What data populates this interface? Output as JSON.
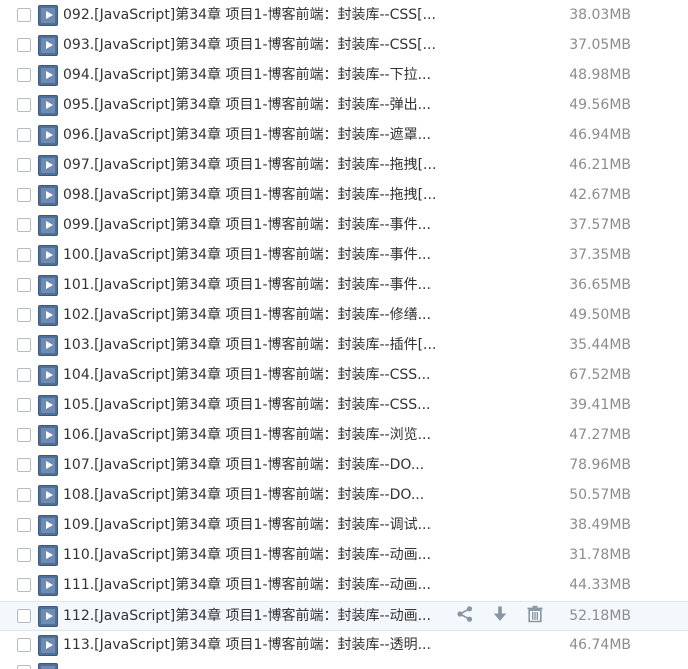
{
  "files": [
    {
      "name": "092.[JavaScript]第34章 项目1-博客前端：封装库--CSS[...",
      "size": "38.03MB"
    },
    {
      "name": "093.[JavaScript]第34章 项目1-博客前端：封装库--CSS[...",
      "size": "37.05MB"
    },
    {
      "name": "094.[JavaScript]第34章 项目1-博客前端：封装库--下拉...",
      "size": "48.98MB"
    },
    {
      "name": "095.[JavaScript]第34章 项目1-博客前端：封装库--弹出...",
      "size": "49.56MB"
    },
    {
      "name": "096.[JavaScript]第34章 项目1-博客前端：封装库--遮罩...",
      "size": "46.94MB"
    },
    {
      "name": "097.[JavaScript]第34章 项目1-博客前端：封装库--拖拽[...",
      "size": "46.21MB"
    },
    {
      "name": "098.[JavaScript]第34章 项目1-博客前端：封装库--拖拽[...",
      "size": "42.67MB"
    },
    {
      "name": "099.[JavaScript]第34章 项目1-博客前端：封装库--事件...",
      "size": "37.57MB"
    },
    {
      "name": "100.[JavaScript]第34章 项目1-博客前端：封装库--事件...",
      "size": "37.35MB"
    },
    {
      "name": "101.[JavaScript]第34章 项目1-博客前端：封装库--事件...",
      "size": "36.65MB"
    },
    {
      "name": "102.[JavaScript]第34章 项目1-博客前端：封装库--修缮...",
      "size": "49.50MB"
    },
    {
      "name": "103.[JavaScript]第34章 项目1-博客前端：封装库--插件[...",
      "size": "35.44MB"
    },
    {
      "name": "104.[JavaScript]第34章 项目1-博客前端：封装库--CSS...",
      "size": "67.52MB"
    },
    {
      "name": "105.[JavaScript]第34章 项目1-博客前端：封装库--CSS...",
      "size": "39.41MB"
    },
    {
      "name": "106.[JavaScript]第34章 项目1-博客前端：封装库--浏览...",
      "size": "47.27MB"
    },
    {
      "name": "107.[JavaScript]第34章 项目1-博客前端：封装库--DO...",
      "size": "78.96MB"
    },
    {
      "name": "108.[JavaScript]第34章 项目1-博客前端：封装库--DO...",
      "size": "50.57MB"
    },
    {
      "name": "109.[JavaScript]第34章 项目1-博客前端：封装库--调试...",
      "size": "38.49MB"
    },
    {
      "name": "110.[JavaScript]第34章 项目1-博客前端：封装库--动画...",
      "size": "31.78MB"
    },
    {
      "name": "111.[JavaScript]第34章 项目1-博客前端：封装库--动画...",
      "size": "44.33MB"
    },
    {
      "name": "112.[JavaScript]第34章 项目1-博客前端：封装库--动画...",
      "size": "52.18MB",
      "hovered": true
    },
    {
      "name": "113.[JavaScript]第34章 项目1-博客前端：封装库--透明...",
      "size": "46.74MB"
    }
  ],
  "row_action_icons": [
    "share-icon",
    "download-icon",
    "delete-icon"
  ],
  "colors": {
    "file_name": "#333333",
    "file_size": "#8c8c8c",
    "hover_row_bg": "#f4f8fd",
    "action_icon": "#8a95a3",
    "video_icon": "#4f6f96"
  }
}
